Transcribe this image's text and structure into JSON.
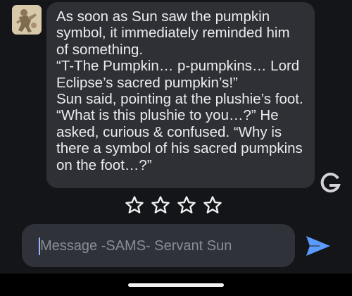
{
  "chat": {
    "avatar_icon": "character-portrait",
    "message_lines": [
      "As soon as Sun saw the pumpkin",
      "symbol, it immediately reminded him",
      "of something.",
      "“T-The Pumpkin… p-pumpkins… Lord",
      "Eclipse’s sacred pumpkin’s!”",
      "Sun said, pointing at the plushie’s foot.",
      "“What is this plushie to you…?” He",
      "asked, curious & confused. “Why is",
      "there a symbol of his sacred pumpkins",
      "on the foot…?”"
    ],
    "regenerate_icon": "regenerate-g-icon",
    "rating": {
      "icon": "star-outline-icon",
      "max": 4,
      "value": 0
    }
  },
  "composer": {
    "placeholder": "Message -SAMS- Servant Sun",
    "send_icon": "send-icon"
  },
  "colors": {
    "background": "#141518",
    "bubble": "#2e3035",
    "input": "#2f3238",
    "send_accent": "#5b9bff",
    "text": "#ececef"
  }
}
